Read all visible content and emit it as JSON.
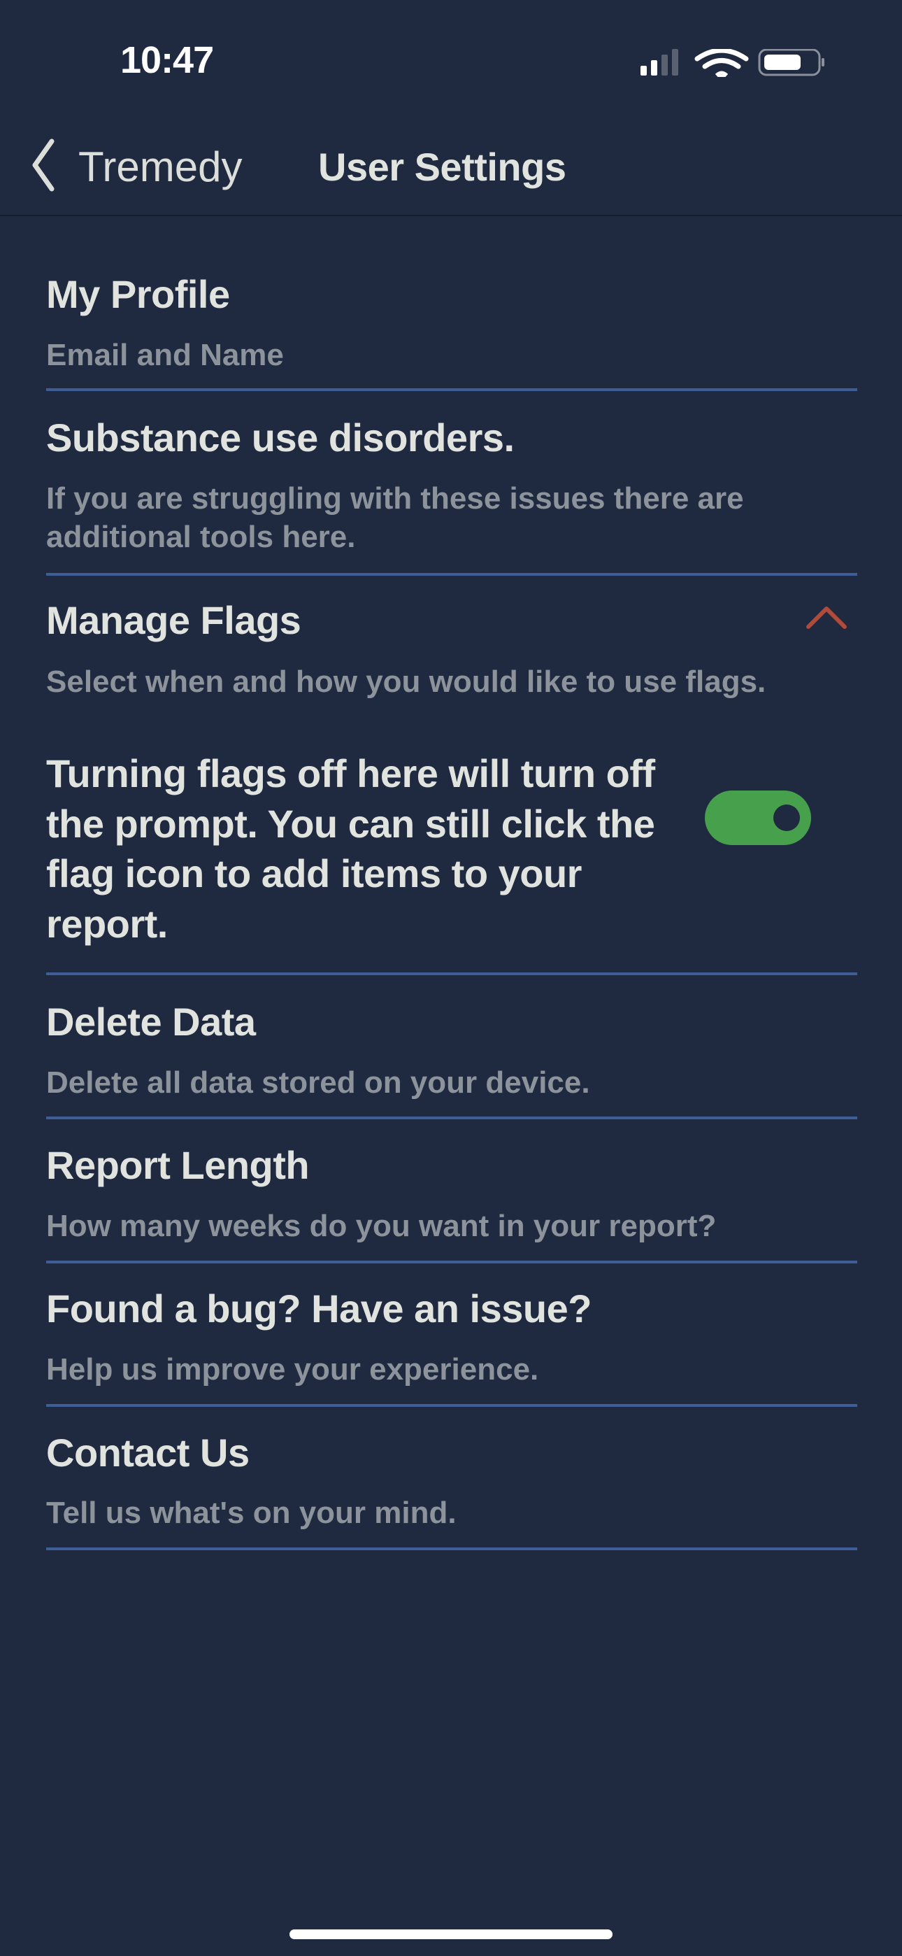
{
  "status_bar": {
    "time": "10:47",
    "signal_icon": "cellular-signal-icon",
    "wifi_icon": "wifi-icon",
    "battery_icon": "battery-icon"
  },
  "nav": {
    "back_label": "Tremedy",
    "title": "User Settings"
  },
  "items": [
    {
      "title": "My Profile",
      "subtitle": "Email and Name"
    },
    {
      "title": "Substance use disorders.",
      "subtitle": "If you are struggling with these issues there are additional tools here."
    },
    {
      "title": "Manage Flags",
      "subtitle": "Select when and how you would like to use flags.",
      "expanded": true,
      "toggle_text": "Turning flags off here will turn off the prompt. You can still click the flag icon to add items to your report.",
      "toggle_on": true
    },
    {
      "title": "Delete Data",
      "subtitle": "Delete all data stored on your device."
    },
    {
      "title": "Report Length",
      "subtitle": "How many weeks do you want in your report?"
    },
    {
      "title": "Found a bug? Have an issue?",
      "subtitle": "Help us improve your experience."
    },
    {
      "title": "Contact Us",
      "subtitle": "Tell us what's on your mind."
    }
  ],
  "colors": {
    "background": "#1f2940",
    "divider": "#3f5e98",
    "toggle_on": "#47a04c",
    "chevron": "#b04a3a",
    "subtitle": "#8d939b"
  }
}
